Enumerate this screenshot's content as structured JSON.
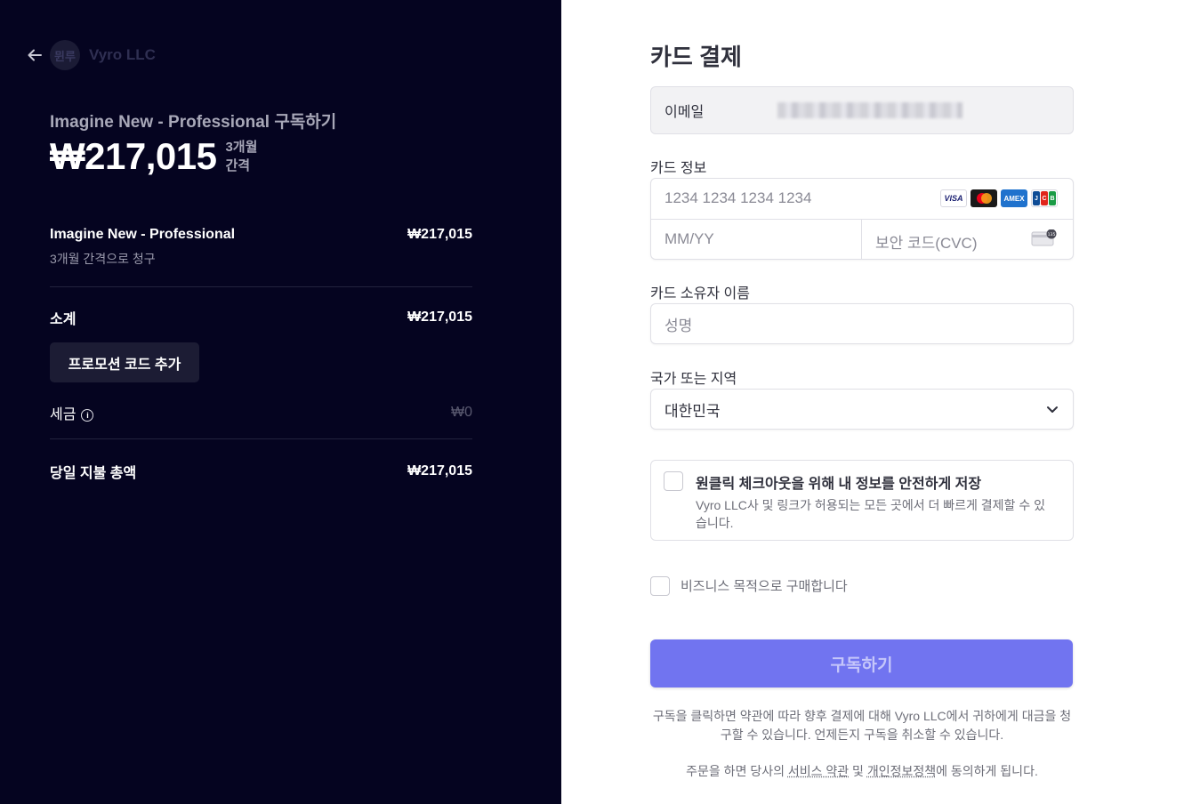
{
  "merchant": {
    "logo_text": "뮌루",
    "name": "Vyro LLC"
  },
  "summary": {
    "title": "Imagine New - Professional 구독하기",
    "price": "₩217,015",
    "period": "3개월 간격",
    "line_item_name": "Imagine New - Professional",
    "line_item_amount": "₩217,015",
    "line_item_billing": "3개월 간격으로 청구",
    "subtotal_label": "소계",
    "subtotal_amount": "₩217,015",
    "promo_button": "프로모션 코드 추가",
    "tax_label": "세금",
    "tax_amount": "₩0",
    "total_label": "당일 지불 총액",
    "total_amount": "₩217,015"
  },
  "form": {
    "title": "카드 결제",
    "email_label": "이메일",
    "card_info_label": "카드 정보",
    "card_number_placeholder": "1234 1234 1234 1234",
    "card_brands": [
      "VISA",
      "Mastercard",
      "AMEX",
      "JCB"
    ],
    "expiry_placeholder": "MM/YY",
    "cvc_placeholder": "보안 코드(CVC)",
    "cvc_icon_number": "135",
    "cardholder_label": "카드 소유자 이름",
    "cardholder_placeholder": "성명",
    "country_label": "국가 또는 지역",
    "country_value": "대한민국",
    "save_info_title": "원클릭 체크아웃을 위해 내 정보를 안전하게 저장",
    "save_info_desc": "Vyro LLC사 및 링크가 허용되는 모든 곳에서 더 빠르게 결제할 수 있습니다.",
    "business_label": "비즈니스 목적으로 구매합니다",
    "subscribe_button": "구독하기",
    "terms_1": "구독을 클릭하면 약관에 따라 향후 결제에 대해 Vyro LLC에서 귀하에게 대금을 청구할 수 있습니다. 언제든지 구독을 취소할 수 있습니다.",
    "terms_2_prefix": "주문을 하면 당사의 ",
    "terms_2_link_service": "서비스 약관",
    "terms_2_and": " 및 ",
    "terms_2_link_privacy": "개인정보정책",
    "terms_2_suffix": "에 동의하게 됩니다."
  },
  "colors": {
    "left_bg": "#050420",
    "button": "#7174f0",
    "text": "#30313d"
  }
}
